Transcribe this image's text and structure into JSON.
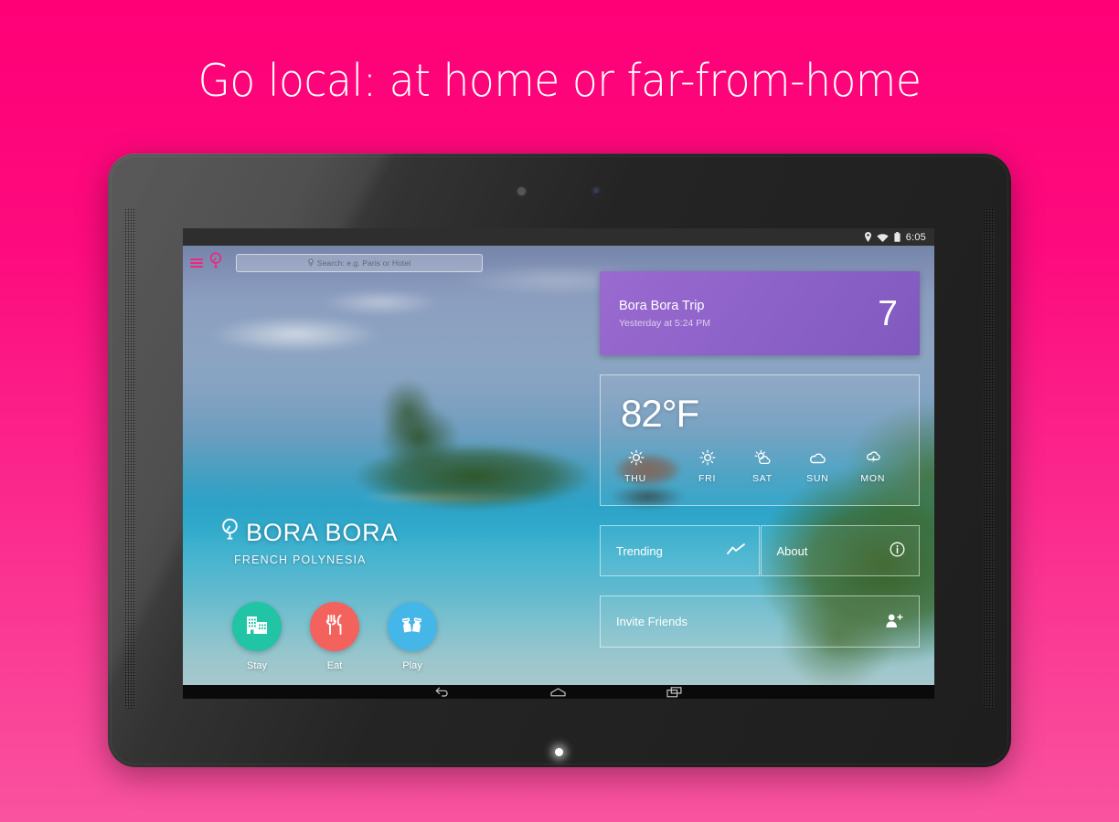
{
  "headline": "Go local: at home or far-from-home",
  "device": {
    "type": "android-tablet"
  },
  "status_bar": {
    "time": "6:05",
    "icons": [
      "location-pin-icon",
      "wifi-icon",
      "battery-icon"
    ]
  },
  "app": {
    "topbar": {
      "menu_icon": "hamburger-menu-icon",
      "logo_icon": "pin-balloon-logo-icon",
      "search_placeholder": "Search: e.g. Paris or Hotel",
      "search_value": ""
    },
    "destination": {
      "name": "BORA BORA",
      "region": "FRENCH POLYNESIA",
      "pin_icon": "location-pin-icon"
    },
    "actions": [
      {
        "label": "Stay",
        "icon": "building-icon",
        "color": "#21c4a4"
      },
      {
        "label": "Eat",
        "icon": "fork-knife-icon",
        "color": "#f3625c"
      },
      {
        "label": "Play",
        "icon": "tickets-icon",
        "color": "#45b6e8"
      }
    ],
    "trip_card": {
      "title": "Bora Bora Trip",
      "subtitle": "Yesterday at 5:24 PM",
      "count": "7",
      "color": "#8e63c9"
    },
    "weather_card": {
      "temperature": "82°F",
      "forecast": [
        {
          "day": "THU",
          "icon": "sun-icon"
        },
        {
          "day": "FRI",
          "icon": "sun-icon"
        },
        {
          "day": "SAT",
          "icon": "partly-sunny-icon"
        },
        {
          "day": "SUN",
          "icon": "cloud-icon"
        },
        {
          "day": "MON",
          "icon": "thunderstorm-icon"
        }
      ]
    },
    "tiles": [
      {
        "label": "Trending",
        "icon": "trend-line-icon"
      },
      {
        "label": "About",
        "icon": "info-circle-icon"
      }
    ],
    "invite": {
      "label": "Invite Friends",
      "icon": "add-person-icon"
    }
  },
  "nav_bar": {
    "back": "back-icon",
    "home": "home-icon",
    "recents": "recents-icon"
  },
  "theme": {
    "background_top": "#ff0077",
    "background_bottom": "#f9539f",
    "accent_pink": "#f0267f"
  }
}
